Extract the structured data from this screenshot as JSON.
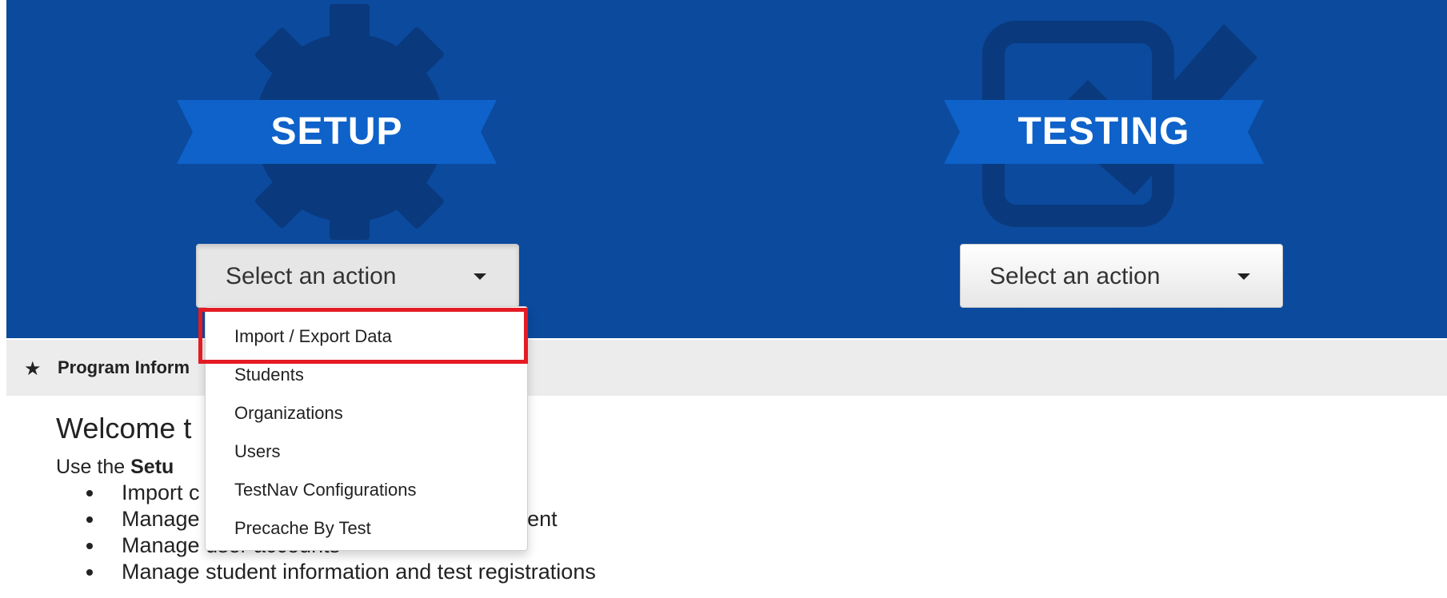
{
  "setup": {
    "title": "SETUP",
    "select_label": "Select an action",
    "menu_items": [
      "Import / Export Data",
      "Students",
      "Organizations",
      "Users",
      "TestNav Configurations",
      "Precache By Test"
    ]
  },
  "testing": {
    "title": "TESTING",
    "select_label": "Select an action"
  },
  "info_bar": {
    "label": "Program Inform"
  },
  "welcome": {
    "heading": "Welcome t",
    "intro_prefix": "Use the ",
    "intro_bold": "Setu",
    "bullets": [
      "Import c",
      "Manage",
      "Manage user accounts",
      "Manage student information and test registrations"
    ],
    "bullet_2_tail": "n, and enrollment"
  },
  "colors": {
    "hero_bg": "#0b4a9d",
    "ribbon": "#0e62c9",
    "icon_dark": "#0a3a7d",
    "highlight": "#e41b23",
    "info_bar_bg": "#ececec"
  },
  "icons": {
    "setup": "gear-icon",
    "testing": "checkbox-icon",
    "info": "star-icon",
    "select": "caret-down-icon"
  }
}
